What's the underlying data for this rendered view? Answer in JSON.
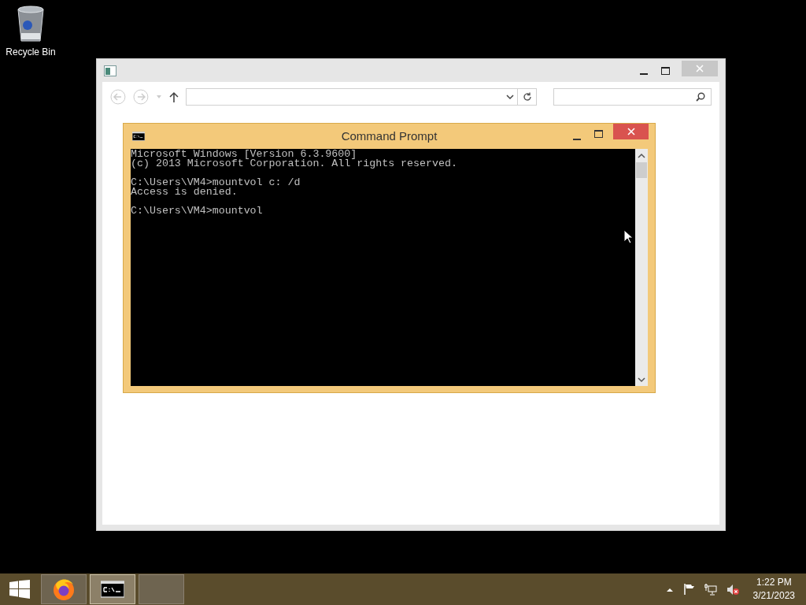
{
  "desktop_icons": [
    {
      "label": "Recycle Bin"
    }
  ],
  "command_prompt": {
    "title": "Command Prompt",
    "blocks": [
      [
        "Microsoft Windows [Version 6.3.9600]",
        "(c) 2013 Microsoft Corporation. All rights reserved."
      ],
      [
        "C:\\Users\\VM4>mountvol c: /d",
        "Access is denied."
      ],
      [
        "C:\\Users\\VM4>mountvol"
      ]
    ]
  },
  "taskbar": {
    "items": [
      {
        "kind": "firefox",
        "selected": false
      },
      {
        "kind": "cmd",
        "selected": true
      },
      {
        "kind": "blank",
        "selected": false
      }
    ],
    "clock": {
      "time": "1:22 PM",
      "date": "3/21/2023"
    }
  }
}
